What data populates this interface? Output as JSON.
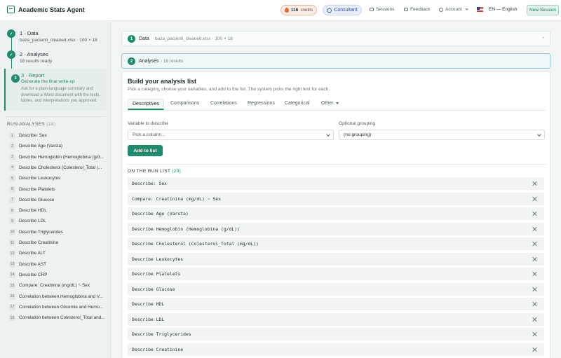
{
  "app": {
    "title": "Academic Stats Agent"
  },
  "topbar": {
    "credits_count": "116",
    "credits_label": "credits",
    "consultant": "Consultant",
    "sessions": "Sessions",
    "feedback": "Feedback",
    "account": "Account",
    "language": "EN — English",
    "new_session": "New Session"
  },
  "steps": [
    {
      "number": "1",
      "title": "1 · Data",
      "subtitle": "baza_pacienti_cleaned.xlsx · 100 × 18"
    },
    {
      "number": "2",
      "title": "2 · Analyses",
      "subtitle": "18 results ready"
    },
    {
      "number": "3",
      "title": "3 · Report",
      "subtitle": "Generate the final write-up",
      "description": "Ask for a plain-language summary and download a Word document with the texts, tables, and interpretations you approved."
    }
  ],
  "run_analyses": {
    "header": "RUN ANALYSES",
    "count": "(18)",
    "items": [
      {
        "num": "1",
        "label": "Describe: Sex"
      },
      {
        "num": "2",
        "label": "Describe Age (Varsta)"
      },
      {
        "num": "3",
        "label": "Describe Hemoglobin (Hemoglobina (g/d..."
      },
      {
        "num": "4",
        "label": "Describe Cholesterol (Colesterol_Total (..."
      },
      {
        "num": "5",
        "label": "Describe Leukocytes"
      },
      {
        "num": "6",
        "label": "Describe Platelets"
      },
      {
        "num": "7",
        "label": "Describe Glucose"
      },
      {
        "num": "8",
        "label": "Describe HDL"
      },
      {
        "num": "9",
        "label": "Describe LDL"
      },
      {
        "num": "10",
        "label": "Describe Triglycerides"
      },
      {
        "num": "11",
        "label": "Describe Creatinine"
      },
      {
        "num": "12",
        "label": "Describe ALT"
      },
      {
        "num": "13",
        "label": "Describe AST"
      },
      {
        "num": "14",
        "label": "Describe CRP"
      },
      {
        "num": "15",
        "label": "Compare: Creatinina (mg/dL) ~ Sex"
      },
      {
        "num": "16",
        "label": "Correlation between Hemoglobina and V..."
      },
      {
        "num": "17",
        "label": "Correlation between Glicemie and Hemo..."
      },
      {
        "num": "18",
        "label": "Correlation between Colesterol_Total and..."
      }
    ]
  },
  "data_card": {
    "number": "1",
    "label": "Data",
    "sub": "· baza_pacienti_cleaned.xlsx · 100 × 18",
    "toggle": "-"
  },
  "analyses_card": {
    "number": "2",
    "label": "Analyses",
    "sub": "· 18 results"
  },
  "builder": {
    "title": "Build your analysis list",
    "description": "Pick a category, choose your variables, and add to the list. The system picks the right test for each.",
    "tabs": [
      "Descriptives",
      "Comparisons",
      "Correlations",
      "Regressions",
      "Categorical",
      "Other"
    ],
    "variable_label": "Variable to describe",
    "variable_placeholder": "Pick a column...",
    "grouping_label": "Optional grouping",
    "grouping_value": "(no grouping)",
    "add_button": "Add to list",
    "list_header": "ON THE RUN LIST",
    "list_count": "(20)",
    "list_items": [
      "Describe: Sex",
      "Compare: Creatinina (mg/dL) ~ Sex",
      "Describe Age (Varsta)",
      "Describe Hemoglobin (Hemoglobina (g/dL))",
      "Describe Cholesterol (Colesterol_Total (mg/dL))",
      "Describe Leukocytes",
      "Describe Platelets",
      "Describe Glucose",
      "Describe HDL",
      "Describe LDL",
      "Describe Triglycerides",
      "Describe Creatinine"
    ]
  },
  "colors": {
    "accent": "#1f8a6c",
    "background": "#f3f5f5"
  }
}
